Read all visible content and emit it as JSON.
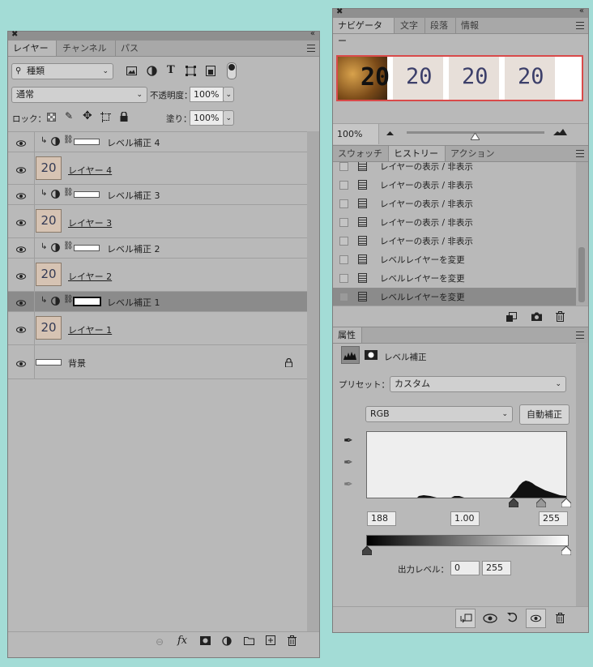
{
  "layers_panel": {
    "tabs": [
      "レイヤー",
      "チャンネル",
      "パス"
    ],
    "filter_kind": "種類",
    "blend_mode": "通常",
    "opacity_label": "不透明度：",
    "opacity_value": "100%",
    "lock_label": "ロック：",
    "fill_label": "塗り：",
    "fill_value": "100%",
    "layers": [
      {
        "type": "adjust",
        "name": "レベル補正 4"
      },
      {
        "type": "pixel",
        "name": "レイヤー 4",
        "thumb": "20"
      },
      {
        "type": "adjust",
        "name": "レベル補正 3"
      },
      {
        "type": "pixel",
        "name": "レイヤー 3",
        "thumb": "20"
      },
      {
        "type": "adjust",
        "name": "レベル補正 2"
      },
      {
        "type": "pixel",
        "name": "レイヤー 2",
        "thumb": "20"
      },
      {
        "type": "adjust",
        "name": "レベル補正 1",
        "selected": true
      },
      {
        "type": "pixel",
        "name": "レイヤー 1",
        "thumb": "20"
      },
      {
        "type": "background",
        "name": "背景"
      }
    ],
    "footer_fx": "fx"
  },
  "navigator": {
    "tabs": [
      "ナビゲーター",
      "文字",
      "段落",
      "情報"
    ],
    "preview_text": [
      "20",
      "20",
      "20",
      "20"
    ],
    "zoom": "100%"
  },
  "history": {
    "tabs": [
      "スウォッチ",
      "ヒストリー",
      "アクション"
    ],
    "items": [
      "レイヤーの表示 / 非表示",
      "レイヤーの表示 / 非表示",
      "レイヤーの表示 / 非表示",
      "レイヤーの表示 / 非表示",
      "レイヤーの表示 / 非表示",
      "レベルレイヤーを変更",
      "レベルレイヤーを変更",
      "レベルレイヤーを変更"
    ]
  },
  "properties": {
    "tab": "属性",
    "title": "レベル補正",
    "preset_label": "プリセット：",
    "preset_value": "カスタム",
    "channel": "RGB",
    "auto_button": "自動補正",
    "input_black": "188",
    "input_gamma": "1.00",
    "input_white": "255",
    "output_label": "出力レベル：",
    "output_black": "0",
    "output_white": "255"
  }
}
